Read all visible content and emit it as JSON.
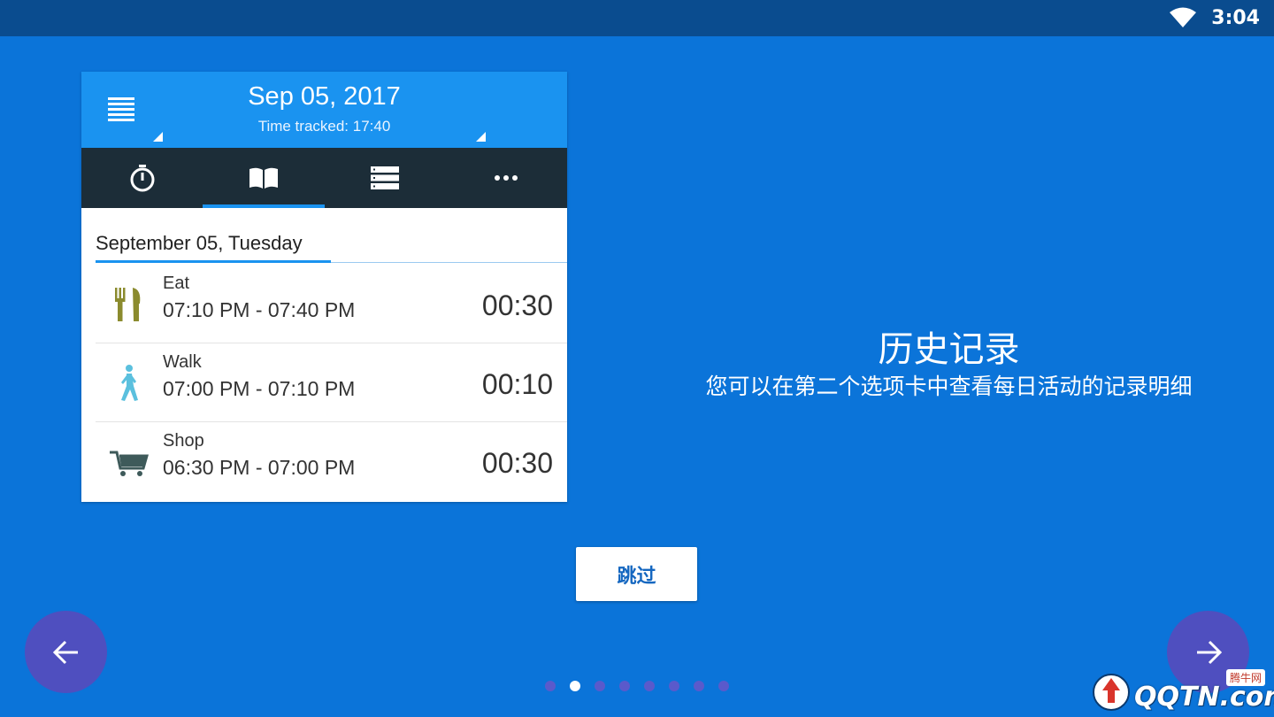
{
  "status_bar": {
    "time": "3:04",
    "wifi_icon": "wifi-icon"
  },
  "preview": {
    "header": {
      "date": "Sep 05, 2017",
      "time_tracked": "Time tracked: 17:40"
    },
    "tabs": [
      {
        "icon": "stopwatch-icon",
        "active": false
      },
      {
        "icon": "book-icon",
        "active": true
      },
      {
        "icon": "list-icon",
        "active": false
      },
      {
        "icon": "more-icon",
        "active": false
      }
    ],
    "day_header": "September 05, Tuesday",
    "entries": [
      {
        "name": "Eat",
        "range": "07:10 PM - 07:40 PM",
        "duration": "00:30",
        "icon": "fork-knife-icon",
        "icon_color": "#8b8b2e"
      },
      {
        "name": "Walk",
        "range": "07:00 PM - 07:10 PM",
        "duration": "00:10",
        "icon": "walking-person-icon",
        "icon_color": "#5bc0de"
      },
      {
        "name": "Shop",
        "range": "06:30 PM - 07:00 PM",
        "duration": "00:30",
        "icon": "shopping-cart-icon",
        "icon_color": "#3e5a5a"
      }
    ]
  },
  "onboarding": {
    "title": "历史记录",
    "description": "您可以在第二个选项卡中查看每日活动的记录明细",
    "skip_label": "跳过",
    "page_count": 8,
    "current_page": 2
  },
  "watermark": {
    "text": "QQTN.com",
    "badge": "腾牛网"
  },
  "colors": {
    "background": "#0b74d9",
    "status_bar": "#0a4c8f",
    "app_header": "#1a93f0",
    "tab_bar": "#1c2d38",
    "nav_button": "#4f4fbf"
  }
}
